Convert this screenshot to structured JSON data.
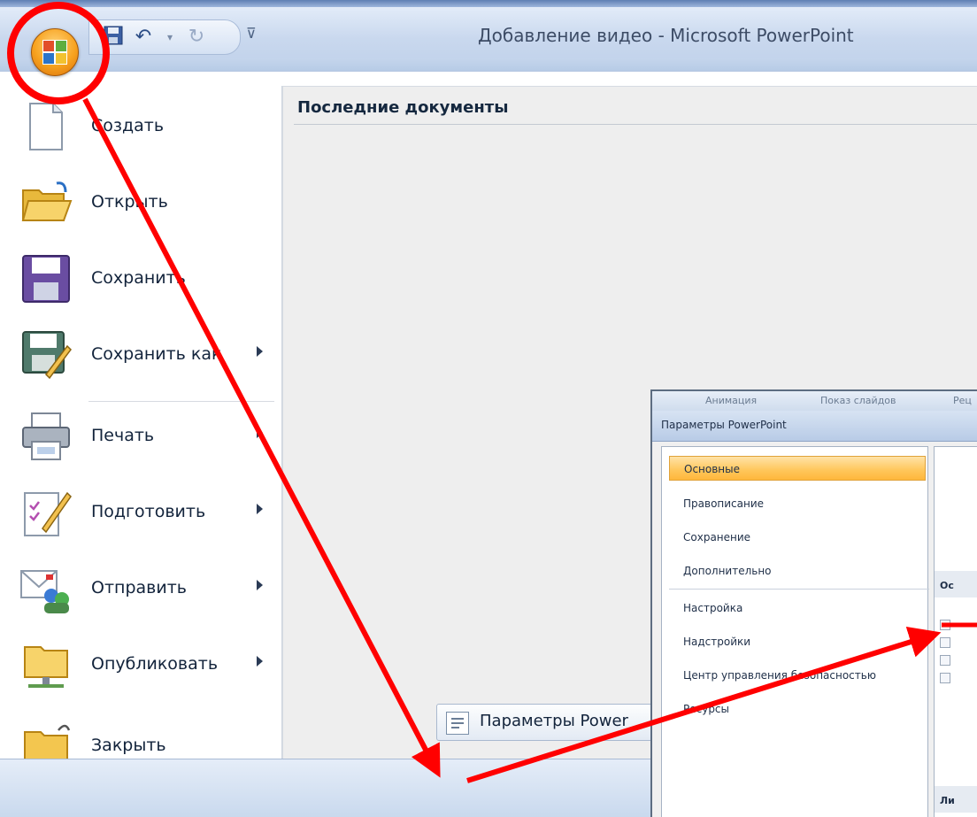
{
  "window": {
    "title": "Добавление видео - Microsoft PowerPoint"
  },
  "office_menu": {
    "recent_title": "Последние документы",
    "items": [
      {
        "label": "Создать",
        "icon": "new-document-icon",
        "has_submenu": false
      },
      {
        "label": "Открыть",
        "icon": "open-folder-icon",
        "has_submenu": false
      },
      {
        "label": "Сохранить",
        "icon": "save-icon",
        "has_submenu": false
      },
      {
        "label": "Сохранить как",
        "icon": "save-as-icon",
        "has_submenu": true
      },
      {
        "label": "Печать",
        "icon": "printer-icon",
        "has_submenu": true
      },
      {
        "label": "Подготовить",
        "icon": "prepare-icon",
        "has_submenu": true
      },
      {
        "label": "Отправить",
        "icon": "send-icon",
        "has_submenu": true
      },
      {
        "label": "Опубликовать",
        "icon": "publish-icon",
        "has_submenu": true
      },
      {
        "label": "Закрыть",
        "icon": "close-folder-icon",
        "has_submenu": false
      }
    ],
    "options_button": "Параметры Power"
  },
  "options_dialog": {
    "title": "Параметры PowerPoint",
    "ribbon_tabs": [
      "Анимация",
      "Показ слайдов",
      "Рец"
    ],
    "nav_items": [
      "Основные",
      "Правописание",
      "Сохранение",
      "Дополнительно",
      "Настройка",
      "Надстройки",
      "Центр управления безопасностью",
      "Ресурсы"
    ],
    "content_sections": [
      "Ос",
      "Ли"
    ]
  },
  "colors": {
    "annotation": "#ff0000",
    "office_button": "#f7a21f",
    "active_nav": "#ffc65a"
  }
}
